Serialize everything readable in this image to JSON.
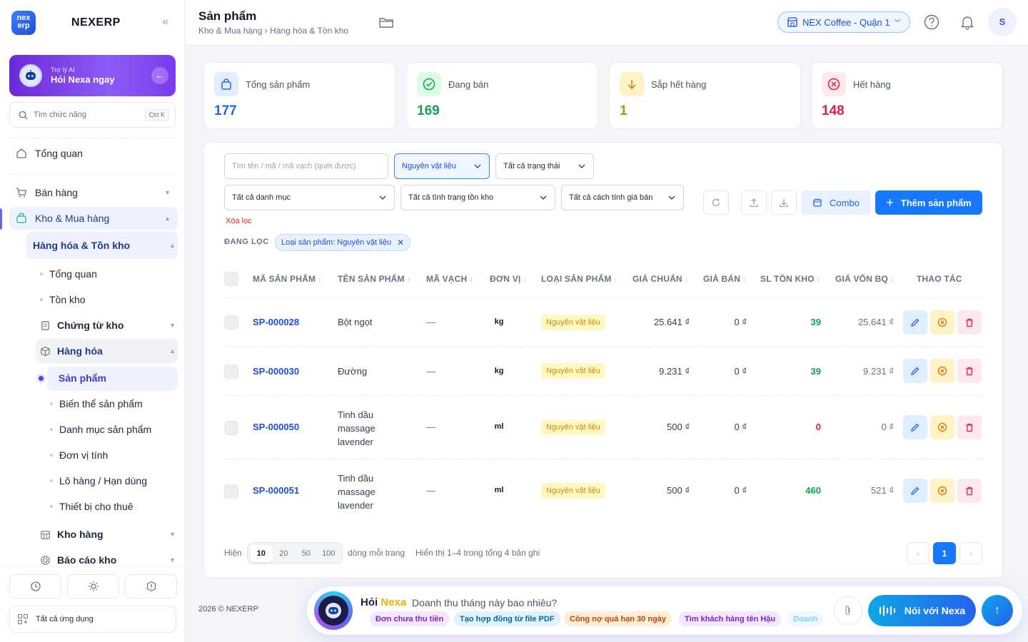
{
  "sidebar": {
    "brand_logo": "nex erp",
    "brand_name": "NEXERP",
    "collapse_icon": "«",
    "ai": {
      "small": "Trợ lý AI",
      "big": "Hỏi Nexa ngay"
    },
    "search": {
      "placeholder": "Tìm chức năng",
      "shortcut": "Ctrl K"
    },
    "nav": {
      "overview": "Tổng quan",
      "sales": "Bán hàng",
      "warehouse": "Kho & Mua hàng",
      "goods_inventory": "Hàng hóa & Tồn kho",
      "sub_overview": "Tổng quan",
      "sub_stock": "Tồn kho",
      "vouchers": "Chứng từ kho",
      "goods": "Hàng hóa",
      "products": "Sản phẩm",
      "variants": "Biến thể sản phẩm",
      "categories": "Danh mục sản phẩm",
      "units": "Đơn vị tính",
      "lots": "Lô hàng / Hạn dùng",
      "rentals": "Thiết bị cho thuê",
      "stores": "Kho hàng",
      "reports": "Báo cáo kho"
    },
    "all_apps": "Tất cả ứng dụng"
  },
  "header": {
    "title": "Sản phẩm",
    "breadcrumb": "Kho & Mua hàng › Hàng hóa & Tồn kho",
    "store": "NEX Coffee - Quận 1",
    "avatar": "S"
  },
  "stats": [
    {
      "label": "Tổng sản phẩm",
      "value": "177",
      "color": "#2563eb"
    },
    {
      "label": "Đang bán",
      "value": "169",
      "color": "#16a34a"
    },
    {
      "label": "Sắp hết hàng",
      "value": "1",
      "color": "#ca8a04"
    },
    {
      "label": "Hết hàng",
      "value": "148",
      "color": "#e11d48"
    }
  ],
  "filters": {
    "search_placeholder": "Tìm tên / mã / mã vạch (quét được)",
    "type": "Nguyên vật liệu",
    "status": "Tất cả trạng thái",
    "category": "Tất cả danh mục",
    "stock_state": "Tất cả tình trạng tồn kho",
    "pricing": "Tất cả cách tính giá bán",
    "combo": "Combo",
    "add": "Thêm sản phẩm",
    "clear": "Xóa lọc",
    "active_label": "ĐANG LỌC",
    "active_chip": "Loại sản phẩm: Nguyên vật liệu"
  },
  "table": {
    "headers": [
      "MÃ SẢN PHẨM",
      "TÊN SẢN PHẨM",
      "MÃ VẠCH",
      "ĐƠN VỊ",
      "LOẠI SẢN PHẨM",
      "GIÁ CHUẨN",
      "GIÁ BÁN",
      "SL TỒN KHO",
      "GIÁ VỐN BQ",
      "THAO TÁC"
    ],
    "rows": [
      {
        "code": "SP-000028",
        "name": "Bột ngọt",
        "barcode": "—",
        "unit": "kg",
        "type": "Nguyên vật liệu",
        "std_price": "25.641 ₫",
        "sale_price": "0 ₫",
        "stock": "39",
        "stock_color": "#16a34a",
        "avg_cost": "25.641 ₫"
      },
      {
        "code": "SP-000030",
        "name": "Đường",
        "barcode": "—",
        "unit": "kg",
        "type": "Nguyên vật liệu",
        "std_price": "9.231 ₫",
        "sale_price": "0 ₫",
        "stock": "39",
        "stock_color": "#16a34a",
        "avg_cost": "9.231 ₫"
      },
      {
        "code": "SP-000050",
        "name": "Tinh dầu massage lavender",
        "barcode": "—",
        "unit": "ml",
        "type": "Nguyên vật liệu",
        "std_price": "500 ₫",
        "sale_price": "0 ₫",
        "stock": "0",
        "stock_color": "#e11d48",
        "avg_cost": "0 ₫"
      },
      {
        "code": "SP-000051",
        "name": "Tinh dầu massage lavender",
        "barcode": "—",
        "unit": "ml",
        "type": "Nguyên vật liệu",
        "std_price": "500 ₫",
        "sale_price": "0 ₫",
        "stock": "460",
        "stock_color": "#16a34a",
        "avg_cost": "521 ₫"
      }
    ]
  },
  "pagination": {
    "show": "Hiện",
    "sizes": [
      "10",
      "20",
      "50",
      "100"
    ],
    "per_page": "dòng mỗi trang",
    "summary": "Hiển thị 1–4 trong tổng 4 bản ghi",
    "current": "1"
  },
  "footer": {
    "copyright": "2026 © NEXERP",
    "nexa_prefix": "Hỏi",
    "nexa_name": "Nexa",
    "question": "Doanh thu tháng này bao nhiêu?",
    "chips": [
      "Đơn chưa thu tiền",
      "Tạo hợp đồng từ file PDF",
      "Công nợ quá hạn 30 ngày",
      "Tìm khách hàng tên Hậu",
      "Doanh"
    ],
    "voice": "Nói với Nexa"
  }
}
